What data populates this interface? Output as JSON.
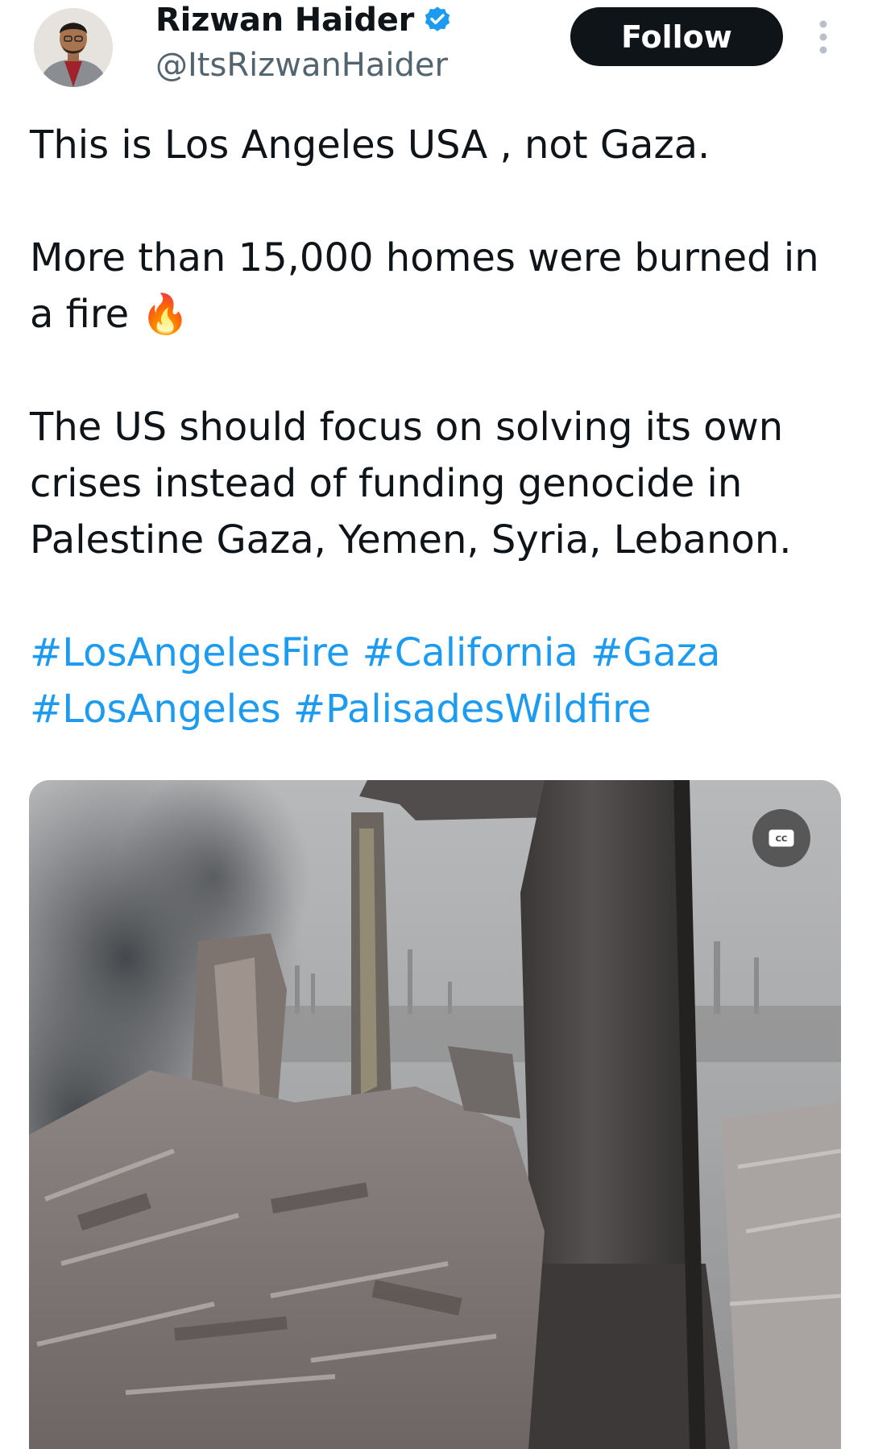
{
  "author": {
    "display_name": "Rizwan Haider",
    "handle": "@ItsRizwanHaider",
    "verified_icon": "verified-badge-icon"
  },
  "actions": {
    "follow_label": "Follow",
    "more_icon": "more-vertical-icon"
  },
  "tweet": {
    "line1": "This is Los Angeles USA , not Gaza.",
    "line2": "More than 15,000 homes were burned in a fire",
    "emoji": "🔥",
    "line3": "The US should focus on solving its own crises instead of funding genocide in Palestine Gaza, Yemen, Syria, Lebanon.",
    "hashtags": [
      "#LosAngelesFire",
      "#California",
      "#Gaza",
      "#LosAngeles",
      "#PalisadesWildfire"
    ]
  },
  "media": {
    "type": "video",
    "cc_label": "CC"
  },
  "colors": {
    "link": "#1d9bf0",
    "text": "#0f1419",
    "secondary": "#536471",
    "follow_bg": "#0f1419"
  }
}
